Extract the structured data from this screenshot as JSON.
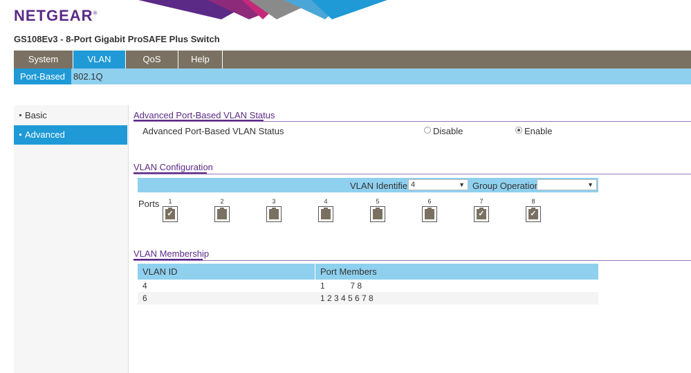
{
  "brand": {
    "logo": "NETGEAR",
    "trademark": "®"
  },
  "product_title": "GS108Ev3 - 8-Port Gigabit ProSAFE Plus Switch",
  "topnav": [
    {
      "label": "System",
      "active": false
    },
    {
      "label": "VLAN",
      "active": true
    },
    {
      "label": "QoS",
      "active": false
    },
    {
      "label": "Help",
      "active": false
    }
  ],
  "subnav": [
    {
      "label": "Port-Based",
      "active": true
    },
    {
      "label": "802.1Q",
      "active": false
    }
  ],
  "sidebar": [
    {
      "label": "Basic",
      "active": false
    },
    {
      "label": "Advanced",
      "active": true
    }
  ],
  "status_section": {
    "title": "Advanced Port-Based VLAN Status",
    "row_label": "Advanced Port-Based VLAN Status",
    "disable_label": "Disable",
    "enable_label": "Enable",
    "selected": "Enable"
  },
  "config_section": {
    "title": "VLAN Configuration",
    "vlan_identifier_label": "VLAN Identifier",
    "vlan_identifier_value": "4",
    "group_operation_label": "Group Operation",
    "group_operation_value": "",
    "ports_label": "Ports",
    "ports": [
      {
        "number": "1",
        "checked": true
      },
      {
        "number": "2",
        "checked": false
      },
      {
        "number": "3",
        "checked": false
      },
      {
        "number": "4",
        "checked": false
      },
      {
        "number": "5",
        "checked": false
      },
      {
        "number": "6",
        "checked": false
      },
      {
        "number": "7",
        "checked": true
      },
      {
        "number": "8",
        "checked": true
      }
    ]
  },
  "membership_section": {
    "title": "VLAN Membership",
    "columns": [
      "VLAN ID",
      "Port Members"
    ],
    "rows": [
      {
        "vlan_id": "4",
        "members": "1           7 8"
      },
      {
        "vlan_id": "6",
        "members": "1 2 3 4 5 6 7 8"
      }
    ]
  },
  "colors": {
    "accent": "#1f9ad6",
    "nav": "#7a7162",
    "light": "#8fd0ef",
    "purple": "#5b2a86"
  }
}
